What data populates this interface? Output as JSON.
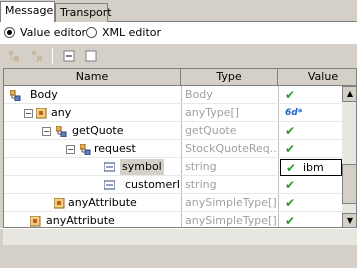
{
  "tabs": [
    {
      "label": "Message",
      "active": true
    },
    {
      "label": "Transport",
      "active": false
    }
  ],
  "editor_modes": [
    {
      "label": "Value editor",
      "selected": true
    },
    {
      "label": "XML editor",
      "selected": false
    }
  ],
  "columns": [
    "Name",
    "Type",
    "Value"
  ],
  "rows": [
    {
      "name": "Body",
      "type": "Body",
      "value": "",
      "value_icon": "check-icon"
    },
    {
      "name": "any",
      "type": "anyType[]",
      "value": "",
      "value_icon": "any-type-icon",
      "value_icon_text": "6d*"
    },
    {
      "name": "getQuote",
      "type": "getQuote",
      "value": "",
      "value_icon": "check-icon"
    },
    {
      "name": "request",
      "type": "StockQuoteReq...",
      "value": "",
      "value_icon": "check-icon"
    },
    {
      "name": "symbol",
      "type": "string",
      "value": "ibm",
      "value_icon": "check-icon",
      "selected": true
    },
    {
      "name": "customerID",
      "type": "string",
      "value": "",
      "value_icon": "check-icon"
    },
    {
      "name": "anyAttribute",
      "type": "anySimpleType[]",
      "value": "",
      "value_icon": "attr-check-icon"
    },
    {
      "name": "anyAttribute",
      "type": "anySimpleType[]",
      "value": "",
      "value_icon": "attr-check-icon"
    }
  ],
  "colors": {
    "chrome": "#d4d0c8",
    "check": "#2a9a2a",
    "type_text": "#a0a0a0"
  }
}
